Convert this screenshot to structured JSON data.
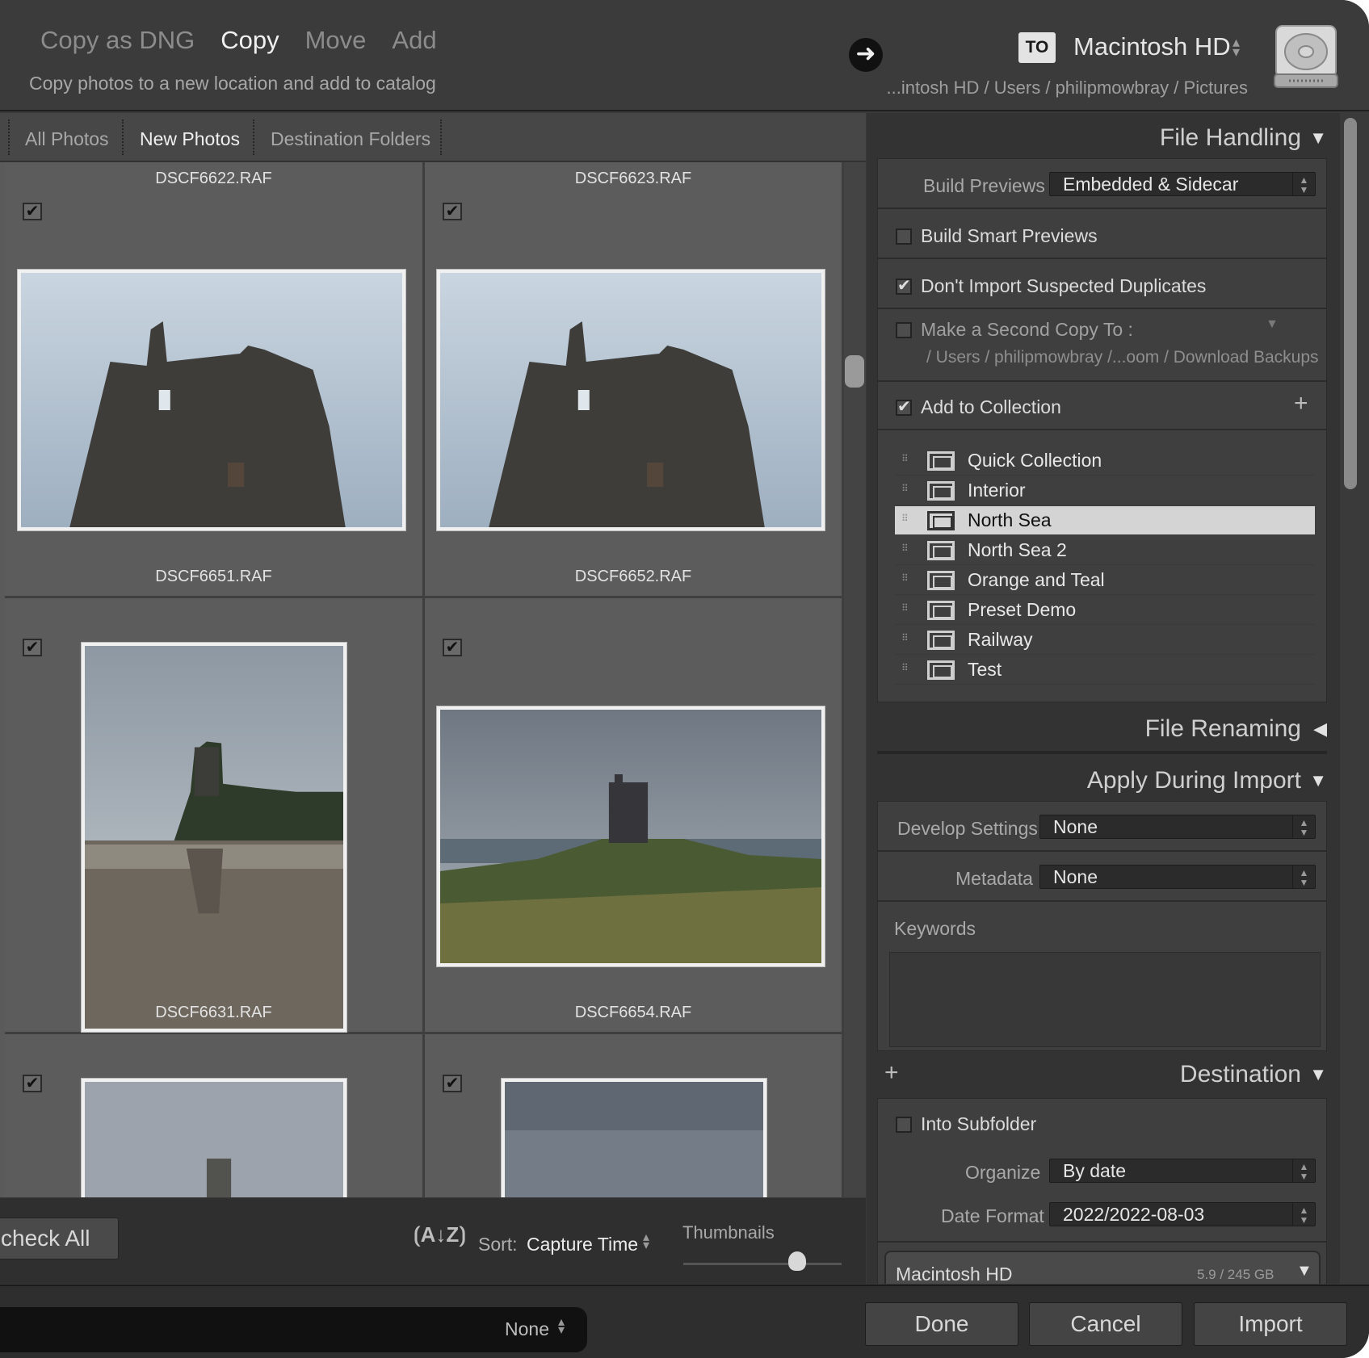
{
  "header": {
    "modes": [
      "Copy as DNG",
      "Copy",
      "Move",
      "Add"
    ],
    "active_mode": "Copy",
    "mode_description": "Copy photos to a new location and add to catalog",
    "to_badge": "TO",
    "destination_drive": "Macintosh HD",
    "destination_path": "...intosh HD / Users / philipmowbray / Pictures"
  },
  "tabs": [
    "All Photos",
    "New Photos",
    "Destination Folders"
  ],
  "grid": {
    "rows": [
      {
        "top_labels": [
          "DSCF6622.RAF",
          "DSCF6623.RAF"
        ]
      },
      {
        "top_labels": [
          "DSCF6651.RAF",
          "DSCF6652.RAF"
        ]
      },
      {
        "top_labels": [
          "DSCF6631.RAF",
          "DSCF6654.RAF"
        ]
      }
    ]
  },
  "gridbar": {
    "check_all": "check All",
    "sort_label": "Sort:",
    "sort_value": "Capture Time",
    "thumbnails_label": "Thumbnails",
    "thumbnail_size": 0.7
  },
  "bottombar": {
    "preset_value": "None",
    "done": "Done",
    "cancel": "Cancel",
    "import": "Import"
  },
  "file_handling": {
    "title": "File Handling",
    "build_previews_label": "Build Previews",
    "build_previews_value": "Embedded & Sidecar",
    "build_smart_previews": "Build Smart Previews",
    "dont_import_duplicates": "Don't Import Suspected Duplicates",
    "second_copy": "Make a Second Copy To :",
    "second_copy_path": "/ Users / philipmowbray /...oom / Download Backups",
    "add_to_collection": "Add to Collection",
    "collections": [
      "Quick Collection",
      "Interior",
      "North Sea",
      "North Sea 2",
      "Orange and Teal",
      "Preset Demo",
      "Railway",
      "Test"
    ],
    "selected_collection": "North Sea"
  },
  "file_renaming": {
    "title": "File Renaming"
  },
  "apply_during_import": {
    "title": "Apply During Import",
    "develop_label": "Develop Settings",
    "develop_value": "None",
    "metadata_label": "Metadata",
    "metadata_value": "None",
    "keywords_label": "Keywords"
  },
  "destination": {
    "title": "Destination",
    "into_subfolder": "Into Subfolder",
    "organize_label": "Organize",
    "organize_value": "By date",
    "date_format_label": "Date Format",
    "date_format_value": "2022/2022-08-03",
    "drive_name": "Macintosh HD",
    "drive_space": "5.9 / 245 GB"
  },
  "icons": {
    "arrow": "arrow-right-icon",
    "drive": "hard-drive-icon",
    "checkmark": "✔",
    "triangle_down": "▼",
    "triangle_left": "◀",
    "plus": "+"
  }
}
